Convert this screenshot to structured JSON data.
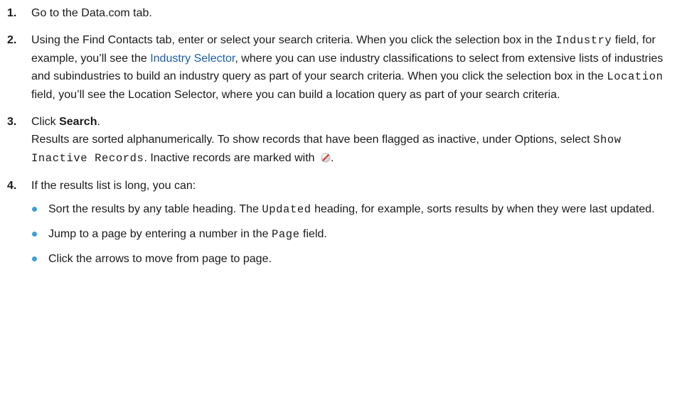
{
  "colors": {
    "link": "#1b5faa",
    "bullet": "#3a9fd8",
    "inactive_icon": "#d43a3a"
  },
  "steps": [
    {
      "num": "1.",
      "text": "Go to the Data.com tab."
    },
    {
      "num": "2.",
      "t1": "Using the Find Contacts tab, enter or select your search criteria. When you click the selection box in the ",
      "code1": "Industry",
      "t2": " field, for example, you’ll see the ",
      "link": "Industry Selector",
      "t3": ", where you can use industry classifications to select from extensive lists of industries and subindustries to build an industry query as part of your search criteria. When you click the selection box in the ",
      "code2": "Location",
      "t4": " field, you’ll see the Location Selector, where you can build a location query as part of your search criteria."
    },
    {
      "num": "3.",
      "t1": "Click ",
      "bold": "Search",
      "t2": ".",
      "r1": "Results are sorted alphanumerically. To show records that have been flagged as inactive, under Options, select ",
      "code": "Show Inactive Records",
      "r2": ". Inactive records are marked with ",
      "icon": "inactive-record-icon",
      "r3": "."
    },
    {
      "num": "4.",
      "text": "If the results list is long, you can:",
      "bullets": [
        {
          "t1": "Sort the results by any table heading. The ",
          "code": "Updated",
          "t2": " heading, for example, sorts results by when they were last updated."
        },
        {
          "t1": "Jump to a page by entering a number in the ",
          "code": "Page",
          "t2": " field."
        },
        {
          "t1": "Click the arrows to move from page to page."
        }
      ]
    }
  ]
}
